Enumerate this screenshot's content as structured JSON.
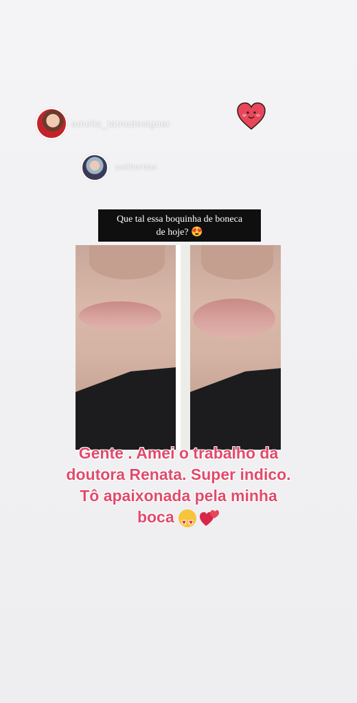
{
  "story": {
    "users": [
      {
        "username": "amelia_tatnodesigner",
        "avatar_icon": "profile-photo-icon"
      },
      {
        "username": "pelibordas",
        "avatar_icon": "profile-photo-icon"
      }
    ],
    "sticker_icon": "smiling-heart-sticker",
    "caption_line1": "Que tal essa boquinha de boneca",
    "caption_line2": "de hoje? 😍",
    "photos": [
      "before-lips-photo",
      "after-lips-photo"
    ],
    "testimonial": {
      "line1": "Gente . Amei o trabalho da",
      "line2": "doutora Renata. Super indico.",
      "line3": "Tô apaixonada pela minha",
      "line4": "boca"
    },
    "colors": {
      "testimonial_text": "#e04b6b",
      "caption_bg": "#0f0f0f",
      "heart": "#e8475a"
    }
  }
}
